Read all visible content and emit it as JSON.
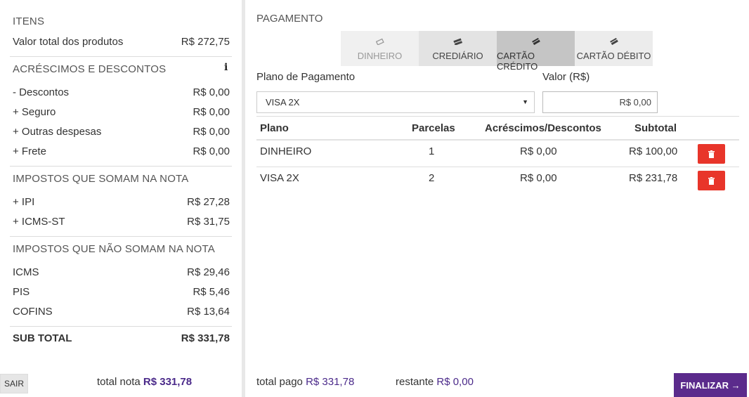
{
  "itens": {
    "title": "ITENS",
    "valor_total_label": "Valor total dos produtos",
    "valor_total_value": "R$ 272,75"
  },
  "acrescimos": {
    "title": "ACRÉSCIMOS E DESCONTOS",
    "info_icon": "i",
    "rows": [
      {
        "label": "- Descontos",
        "value": "R$ 0,00"
      },
      {
        "label": "+ Seguro",
        "value": "R$ 0,00"
      },
      {
        "label": "+ Outras despesas",
        "value": "R$ 0,00"
      },
      {
        "label": "+ Frete",
        "value": "R$ 0,00"
      }
    ]
  },
  "impostos_somam": {
    "title": "IMPOSTOS QUE SOMAM NA NOTA",
    "rows": [
      {
        "label": "+ IPI",
        "value": "R$ 27,28"
      },
      {
        "label": "+ ICMS-ST",
        "value": "R$ 31,75"
      }
    ]
  },
  "impostos_nao_somam": {
    "title": "IMPOSTOS QUE NÃO SOMAM NA NOTA",
    "rows": [
      {
        "label": "ICMS",
        "value": "R$ 29,46"
      },
      {
        "label": "PIS",
        "value": "R$ 5,46"
      },
      {
        "label": "COFINS",
        "value": "R$ 13,64"
      }
    ]
  },
  "sub_total": {
    "label": "SUB TOTAL",
    "value": "R$ 331,78"
  },
  "footer_left": {
    "sair_label": "SAIR",
    "total_nota_label": "total nota",
    "total_nota_value": "R$ 331,78"
  },
  "pagamento": {
    "title": "PAGAMENTO",
    "tabs": [
      {
        "label": "DINHEIRO",
        "icon": "money-icon"
      },
      {
        "label": "CREDIÁRIO",
        "icon": "cash-stack-icon"
      },
      {
        "label": "CARTÃO CRÉDITO",
        "icon": "credit-card-icon",
        "active": true
      },
      {
        "label": "CARTÃO DÉBITO",
        "icon": "debit-card-icon"
      }
    ],
    "plano_label": "Plano de Pagamento",
    "plano_selected": "VISA 2X",
    "valor_label": "Valor (R$)",
    "valor_value": "R$ 0,00",
    "table": {
      "headers": [
        "Plano",
        "Parcelas",
        "Acréscimos/Descontos",
        "Subtotal"
      ],
      "rows": [
        {
          "plano": "DINHEIRO",
          "parcelas": "1",
          "acrescimos": "R$ 0,00",
          "subtotal": "R$ 100,00"
        },
        {
          "plano": "VISA 2X",
          "parcelas": "2",
          "acrescimos": "R$ 0,00",
          "subtotal": "R$ 231,78"
        }
      ]
    }
  },
  "footer_right": {
    "total_pago_label": "total pago",
    "total_pago_value": "R$ 331,78",
    "restante_label": "restante",
    "restante_value": "R$ 0,00",
    "finalizar_label": "FINALIZAR →"
  },
  "colors": {
    "accent": "#5b2b8c",
    "danger": "#e8352a",
    "value_purple": "#4b2a8a"
  }
}
